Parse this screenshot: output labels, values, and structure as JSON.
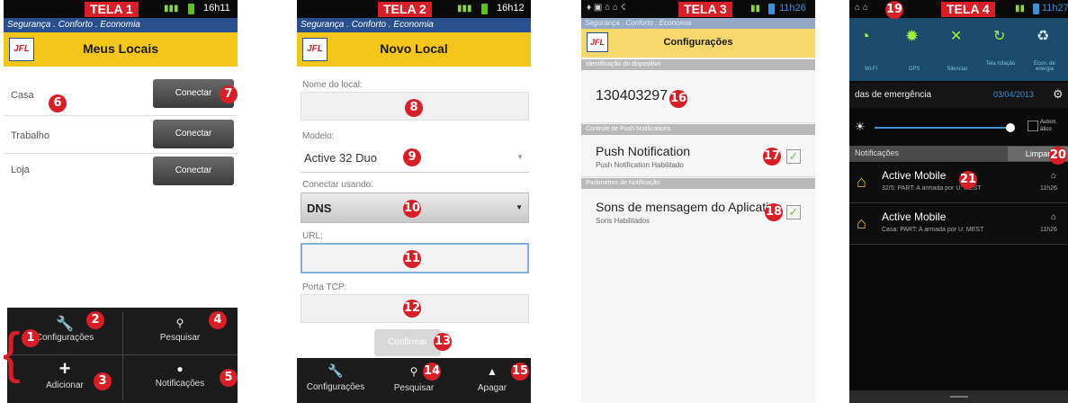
{
  "screen1": {
    "tela": "TELA 1",
    "time": "16h11",
    "banner": "Segurança . Conforto . Economia",
    "logo": "JFL",
    "title": "Meus Locais",
    "items": [
      {
        "label": "Casa",
        "button": "Conectar"
      },
      {
        "label": "Trabalho",
        "button": "Conectar"
      },
      {
        "label": "Loja",
        "button": "Conectar"
      }
    ],
    "menu": {
      "config": "Configurações",
      "search": "Pesquisar",
      "add": "Adicionar",
      "notif": "Notificações"
    }
  },
  "screen2": {
    "tela": "TELA 2",
    "time": "16h12",
    "banner": "Segurança . Conforto . Economia",
    "logo": "JFL",
    "title": "Novo Local",
    "fields": {
      "name_label": "Nome do local:",
      "model_label": "Modelo:",
      "model_value": "Active 32 Duo",
      "connect_label": "Conectar usando:",
      "connect_value": "DNS",
      "url_label": "URL:",
      "port_label": "Porta TCP:"
    },
    "confirm_button": "Confirmar",
    "menu": {
      "config": "Configurações",
      "search": "Pesquisar",
      "delete": "Apagar"
    }
  },
  "screen3": {
    "tela": "TELA 3",
    "time": "11h26",
    "banner": "Segurança . Conforto . Economia",
    "logo": "JFL",
    "title": "Configurações",
    "section1": "Identificação do dispositivo",
    "device_id": "130403297",
    "section2": "Controle de Push Notifications",
    "push_title": "Push Notification",
    "push_sub": "Push Notification Habilitado",
    "section3": "Parâmetros de Notificação",
    "sound_title": "Sons de mensagem do Aplicativo",
    "sound_sub": "Sons Habilitados"
  },
  "screen4": {
    "tela": "TELA 4",
    "time": "11h27",
    "quick": [
      "Wi-Fi",
      "GPS",
      "Silenciar",
      "Tela rotação",
      "Econ. de energia"
    ],
    "emergency": "das de emergência",
    "date": "03/04/2013",
    "auto_label": "Autom. ático",
    "notif_header": "Notificações",
    "clear_button": "Limpar",
    "notifications": [
      {
        "title": "Active Mobile",
        "text": "32/5: PART: A armada por U: MEST",
        "time": "11h26"
      },
      {
        "title": "Active Mobile",
        "text": "Casa: PART: A armada por U: MEST",
        "time": "11h26"
      }
    ]
  },
  "badges": [
    "1",
    "2",
    "3",
    "4",
    "5",
    "6",
    "7",
    "8",
    "9",
    "10",
    "11",
    "12",
    "13",
    "14",
    "15",
    "16",
    "17",
    "18",
    "19",
    "20",
    "21"
  ]
}
